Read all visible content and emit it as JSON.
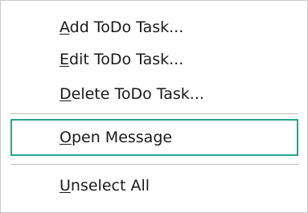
{
  "menu": {
    "items": [
      {
        "accelerator": "A",
        "rest": "dd ToDo Task..."
      },
      {
        "accelerator": "E",
        "rest": "dit ToDo Task..."
      },
      {
        "accelerator": "D",
        "rest": "elete ToDo Task..."
      },
      {
        "accelerator": "O",
        "rest": "pen Message"
      },
      {
        "accelerator": "U",
        "rest": "nselect All"
      }
    ],
    "highlight_color": "#27a58c"
  }
}
